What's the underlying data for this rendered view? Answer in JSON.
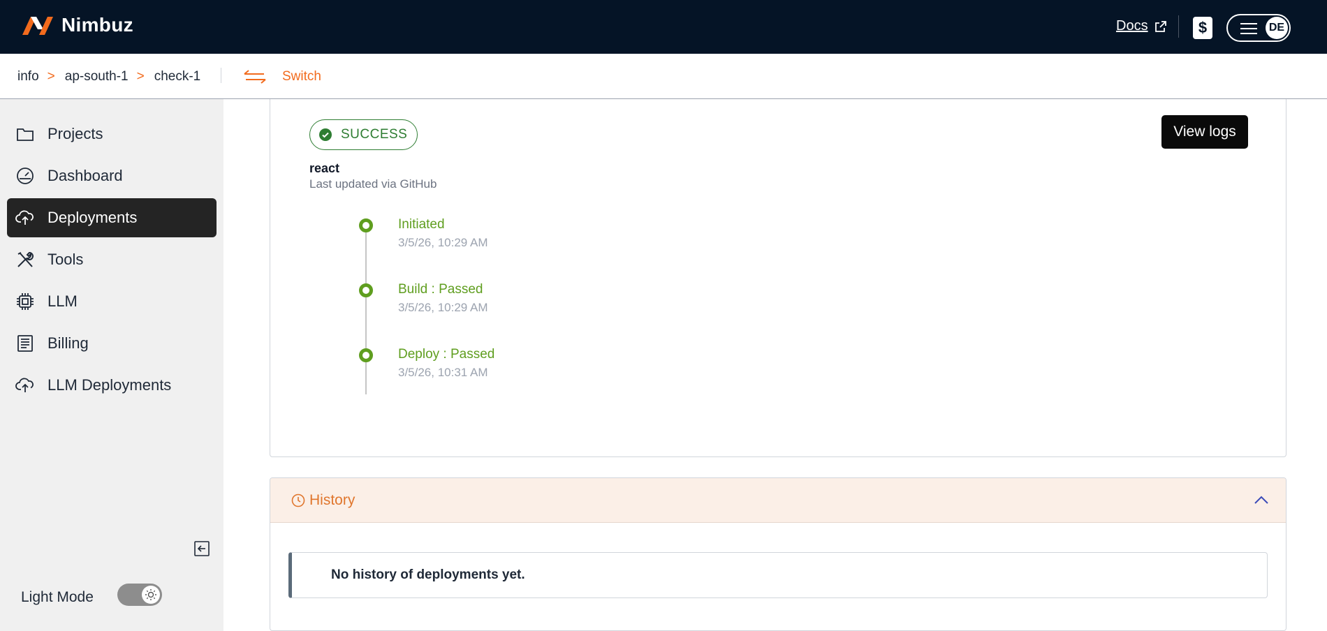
{
  "brand": {
    "name": "Nimbuz",
    "accent": "#f26b1d",
    "nav_bg": "#051426"
  },
  "header": {
    "docs_label": "Docs",
    "billing_icon": "dollar-icon",
    "user_initials": "DE"
  },
  "breadcrumb": {
    "items": [
      "info",
      "ap-south-1",
      "check-1"
    ],
    "separator": ">",
    "switch_label": "Switch"
  },
  "sidebar": {
    "items": [
      {
        "label": "Projects",
        "icon": "folder-icon",
        "active": false
      },
      {
        "label": "Dashboard",
        "icon": "gauge-icon",
        "active": false
      },
      {
        "label": "Deployments",
        "icon": "cloud-upload-icon",
        "active": true
      },
      {
        "label": "Tools",
        "icon": "tools-icon",
        "active": false
      },
      {
        "label": "LLM",
        "icon": "chip-icon",
        "active": false
      },
      {
        "label": "Billing",
        "icon": "receipt-icon",
        "active": false
      },
      {
        "label": "LLM Deployments",
        "icon": "cloud-upload-icon",
        "active": false
      }
    ],
    "light_mode_label": "Light Mode"
  },
  "deployment": {
    "status": "SUCCESS",
    "status_color": "#2e7d32",
    "view_logs_label": "View logs",
    "app_name": "react",
    "updated_text": "Last updated via GitHub",
    "steps": [
      {
        "title": "Initiated",
        "time": "3/5/26, 10:29 AM"
      },
      {
        "title": "Build : Passed",
        "time": "3/5/26, 10:29 AM"
      },
      {
        "title": "Deploy : Passed",
        "time": "3/5/26, 10:31 AM"
      }
    ],
    "step_color": "#5f9e1f"
  },
  "history": {
    "title": "History",
    "empty_text": "No history of deployments yet."
  }
}
